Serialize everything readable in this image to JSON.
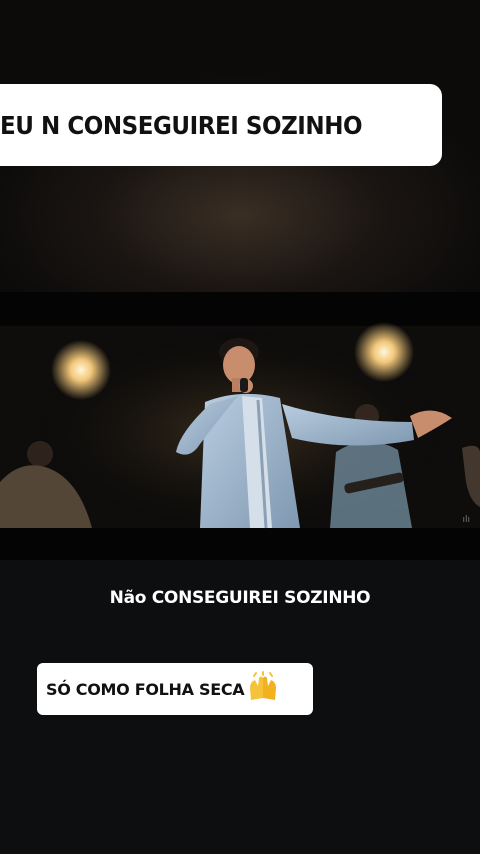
{
  "top_caption": {
    "text": "EU N CONSEGUIREI SOZINHO"
  },
  "video_subtitle": {
    "text": "Não CONSEGUIREI SOZINHO"
  },
  "bottom_caption": {
    "text": "SÓ COMO FOLHA SECA",
    "emoji": "raised-hands-emoji"
  },
  "colors": {
    "caption_bg": "#ffffff",
    "caption_text": "#111111",
    "subtitle_text": "#ffffff",
    "suit": "#9bb3c9"
  }
}
